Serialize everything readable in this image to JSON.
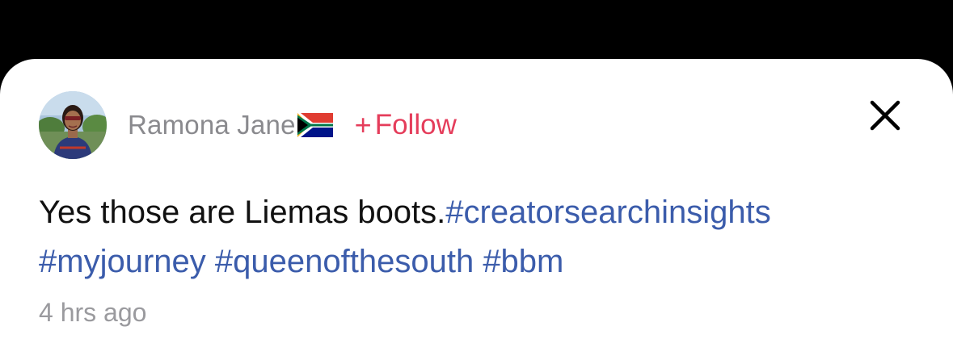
{
  "post": {
    "author": {
      "name": "Ramona Jane",
      "flag_icon": "south-africa-flag-icon",
      "avatar_icon": "profile-photo-avatar"
    },
    "follow": {
      "plus": "+",
      "label": "Follow"
    },
    "close_icon": "close-icon",
    "caption": {
      "text": "Yes those are Liemas boots.",
      "hashtags": [
        "#creatorsearchinsights",
        "#myjourney",
        "#queenofthesouth",
        "#bbm"
      ]
    },
    "timestamp": "4 hrs ago"
  },
  "colors": {
    "background": "#000000",
    "sheet": "#ffffff",
    "author_name": "#8a8a8e",
    "follow": "#e53d5b",
    "caption_text": "#111111",
    "hashtag": "#3b5cab",
    "timestamp": "#9a9a9e"
  }
}
